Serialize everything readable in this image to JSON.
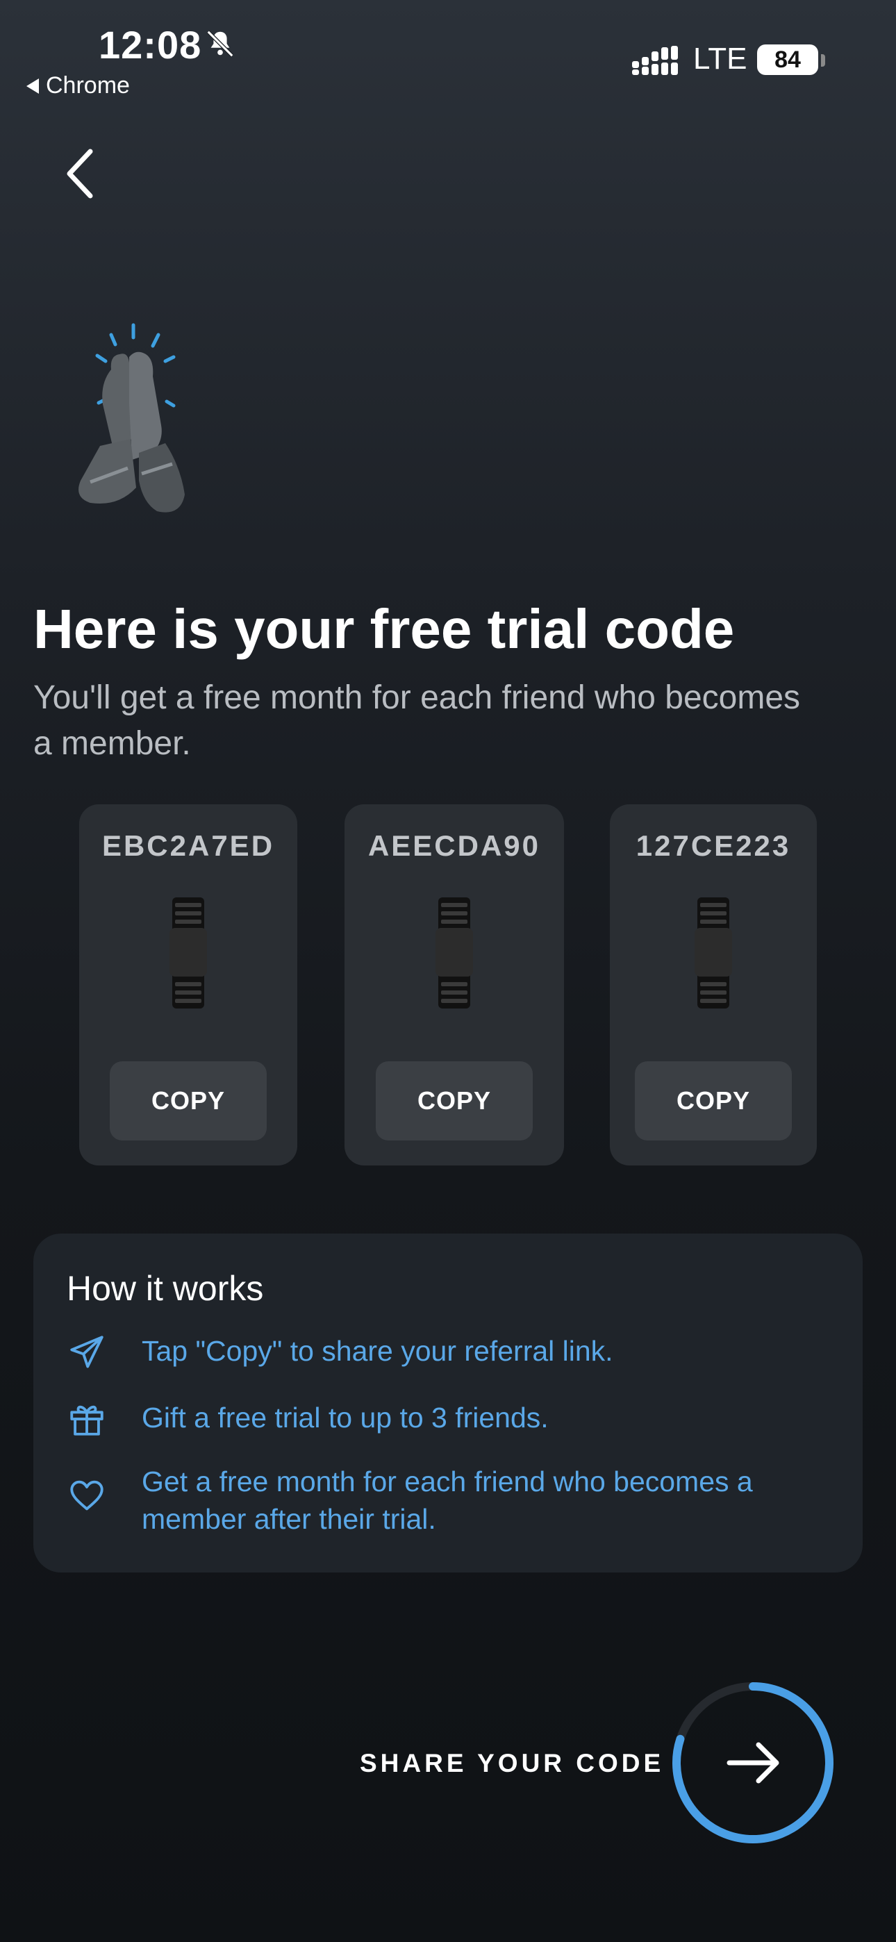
{
  "status_bar": {
    "time": "12:08",
    "back_app": "Chrome",
    "network": "LTE",
    "battery": "84"
  },
  "header": {
    "back_icon": "chevron-left-icon"
  },
  "title": "Here is your free trial code",
  "subtitle": "You'll get a free month for each friend who becomes a member.",
  "codes": [
    {
      "code": "EBC2A7ED",
      "button": "COPY"
    },
    {
      "code": "AEECDA90",
      "button": "COPY"
    },
    {
      "code": "127CE223",
      "button": "COPY"
    }
  ],
  "how_it_works": {
    "title": "How it works",
    "items": [
      {
        "icon": "paper-plane-icon",
        "text": "Tap \"Copy\" to share your referral link."
      },
      {
        "icon": "gift-icon",
        "text": "Gift a free trial to up to 3 friends."
      },
      {
        "icon": "heart-icon",
        "text": "Get a free month for each friend who becomes a member after their trial."
      }
    ]
  },
  "share": {
    "label": "SHARE YOUR CODE",
    "icon": "arrow-right-icon",
    "progress": 0.8
  },
  "colors": {
    "accent": "#5aa8e8",
    "card": "#2a2e33",
    "button": "#3b3f44"
  }
}
